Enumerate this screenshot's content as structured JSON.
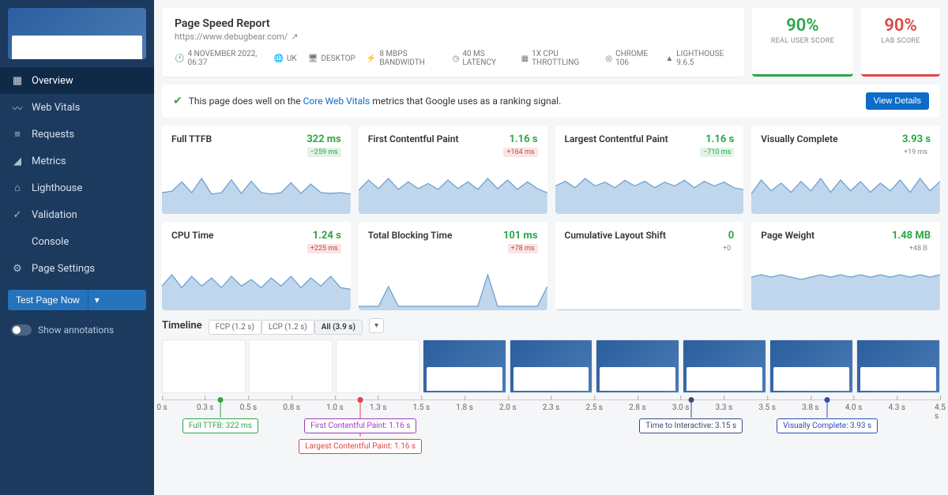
{
  "sidebar": {
    "items": [
      {
        "label": "Overview",
        "active": true,
        "icon": "grid"
      },
      {
        "label": "Web Vitals",
        "active": false,
        "icon": "pulse"
      },
      {
        "label": "Requests",
        "active": false,
        "icon": "list"
      },
      {
        "label": "Metrics",
        "active": false,
        "icon": "chart"
      },
      {
        "label": "Lighthouse",
        "active": false,
        "icon": "lighthouse"
      },
      {
        "label": "Validation",
        "active": false,
        "icon": "check"
      },
      {
        "label": "Console",
        "active": false,
        "icon": "code"
      },
      {
        "label": "Page Settings",
        "active": false,
        "icon": "gear"
      }
    ],
    "test_button": "Test Page Now",
    "annotations_label": "Show annotations"
  },
  "header": {
    "title": "Page Speed Report",
    "url": "https://www.debugbear.com/",
    "meta": {
      "date": "4 NOVEMBER 2022, 06:37",
      "region": "UK",
      "device": "DESKTOP",
      "bandwidth": "8 MBPS BANDWIDTH",
      "latency": "40 MS LATENCY",
      "cpu": "1X CPU THROTTLING",
      "browser": "CHROME 106",
      "lighthouse": "LIGHTHOUSE 9.6.5"
    },
    "scores": {
      "real": {
        "value": "90%",
        "label": "REAL USER SCORE"
      },
      "lab": {
        "value": "90%",
        "label": "LAB SCORE"
      }
    }
  },
  "banner": {
    "text1": "This page does well on the ",
    "link": "Core Web Vitals",
    "text2": " metrics that Google uses as a ranking signal.",
    "button": "View Details"
  },
  "metrics": [
    {
      "name": "Full TTFB",
      "value": "322 ms",
      "delta": "−259 ms",
      "delta_kind": "badge-green",
      "val_color": "green"
    },
    {
      "name": "First Contentful Paint",
      "value": "1.16 s",
      "delta": "+164 ms",
      "delta_kind": "badge-red",
      "val_color": "green"
    },
    {
      "name": "Largest Contentful Paint",
      "value": "1.16 s",
      "delta": "−710 ms",
      "delta_kind": "badge-green",
      "val_color": "green"
    },
    {
      "name": "Visually Complete",
      "value": "3.93 s",
      "delta": "+19 ms",
      "delta_kind": "plain",
      "val_color": "green"
    },
    {
      "name": "CPU Time",
      "value": "1.24 s",
      "delta": "+225 ms",
      "delta_kind": "badge-red",
      "val_color": "green"
    },
    {
      "name": "Total Blocking Time",
      "value": "101 ms",
      "delta": "+78 ms",
      "delta_kind": "badge-red",
      "val_color": "green"
    },
    {
      "name": "Cumulative Layout Shift",
      "value": "0",
      "delta": "+0",
      "delta_kind": "plain",
      "val_color": "green"
    },
    {
      "name": "Page Weight",
      "value": "1.48 MB",
      "delta": "+48 B",
      "delta_kind": "plain",
      "val_color": "green"
    }
  ],
  "timeline": {
    "title": "Timeline",
    "chips": [
      "FCP (1.2 s)",
      "LCP (1.2 s)",
      "All (3.9 s)"
    ],
    "active_chip": 2,
    "ticks": [
      "0 s",
      "0.3 s",
      "0.5 s",
      "0.8 s",
      "1.0 s",
      "1.3 s",
      "1.5 s",
      "1.8 s",
      "2.0 s",
      "2.3 s",
      "2.5 s",
      "2.8 s",
      "3.0 s",
      "3.3 s",
      "3.5 s",
      "3.8 s",
      "4.0 s",
      "4.3 s",
      "4.5 s"
    ],
    "markers": [
      {
        "text": "Full TTFB: 322 ms",
        "color": "#2aa746",
        "pos_pct": 7.5,
        "row": 1
      },
      {
        "text": "First Contentful Paint: 1.16 s",
        "color": "#9c3eb8",
        "pos_pct": 25.5,
        "row": 1
      },
      {
        "text": "Largest Contentful Paint: 1.16 s",
        "color": "#e04545",
        "pos_pct": 25.5,
        "row": 2
      },
      {
        "text": "Time to Interactive: 3.15 s",
        "color": "#3a4a7a",
        "pos_pct": 68,
        "row": 1
      },
      {
        "text": "Visually Complete: 3.93 s",
        "color": "#2a4db4",
        "pos_pct": 85.5,
        "row": 1
      }
    ],
    "loaded_from": 3
  },
  "chart_data": {
    "type": "line",
    "title": "Metric sparklines (relative trend, arbitrary units)",
    "xlabel": "",
    "ylabel": "",
    "series": [
      {
        "name": "Full TTFB",
        "values": [
          30,
          32,
          45,
          30,
          50,
          28,
          30,
          48,
          29,
          46,
          30,
          28,
          30,
          44,
          29,
          42,
          30,
          29,
          30,
          28
        ]
      },
      {
        "name": "First Contentful Paint",
        "values": [
          28,
          40,
          30,
          42,
          29,
          38,
          30,
          36,
          29,
          40,
          30,
          38,
          29,
          42,
          30,
          40,
          29,
          38,
          30,
          25
        ]
      },
      {
        "name": "Largest Contentful Paint",
        "values": [
          30,
          35,
          28,
          38,
          30,
          34,
          28,
          36,
          30,
          35,
          28,
          34,
          30,
          36,
          28,
          35,
          30,
          34,
          28,
          26
        ]
      },
      {
        "name": "Visually Complete",
        "values": [
          26,
          44,
          30,
          40,
          28,
          42,
          30,
          46,
          28,
          44,
          30,
          42,
          28,
          40,
          30,
          44,
          28,
          46,
          30,
          42
        ]
      },
      {
        "name": "CPU Time",
        "values": [
          30,
          44,
          28,
          42,
          30,
          40,
          28,
          42,
          30,
          38,
          28,
          40,
          30,
          42,
          28,
          40,
          30,
          42,
          28,
          26
        ]
      },
      {
        "name": "Total Blocking Time",
        "values": [
          5,
          5,
          5,
          30,
          5,
          5,
          5,
          5,
          5,
          5,
          5,
          5,
          5,
          45,
          5,
          5,
          5,
          5,
          5,
          30
        ]
      },
      {
        "name": "Cumulative Layout Shift",
        "values": [
          0,
          0,
          0,
          0,
          0,
          0,
          0,
          0,
          0,
          0,
          0,
          0,
          0,
          0,
          0,
          0,
          0,
          0,
          0,
          0
        ]
      },
      {
        "name": "Page Weight",
        "values": [
          28,
          30,
          28,
          30,
          28,
          26,
          28,
          30,
          28,
          30,
          28,
          30,
          28,
          30,
          28,
          30,
          28,
          30,
          28,
          30
        ]
      }
    ]
  }
}
